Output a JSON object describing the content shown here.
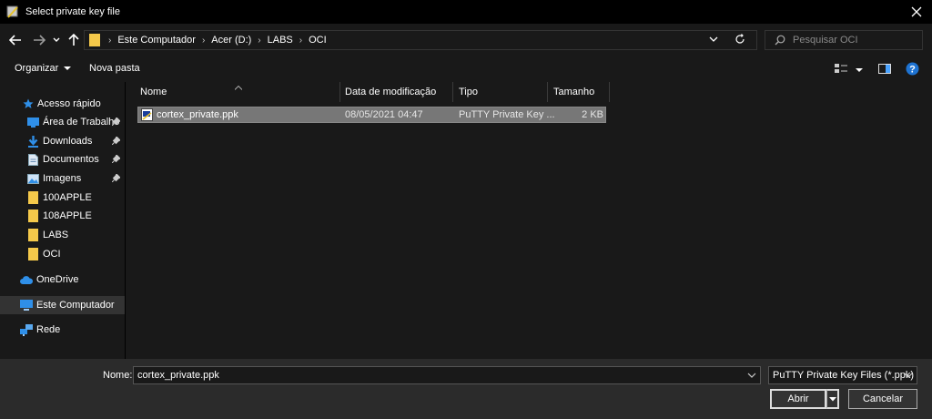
{
  "window": {
    "title": "Select private key file"
  },
  "address": {
    "crumbs": [
      "Este Computador",
      "Acer (D:)",
      "LABS",
      "OCI"
    ]
  },
  "search": {
    "placeholder": "Pesquisar OCI"
  },
  "toolbar": {
    "organize_label": "Organizar",
    "new_folder_label": "Nova pasta"
  },
  "sidebar": {
    "quick_access": "Acesso rápido",
    "items": [
      {
        "label": "Área de Trabalho",
        "icon": "desktop-icon",
        "pinned": true
      },
      {
        "label": "Downloads",
        "icon": "download-icon",
        "pinned": true
      },
      {
        "label": "Documentos",
        "icon": "document-icon",
        "pinned": true
      },
      {
        "label": "Imagens",
        "icon": "image-icon",
        "pinned": true
      },
      {
        "label": "100APPLE",
        "icon": "folder-icon",
        "pinned": false
      },
      {
        "label": "108APPLE",
        "icon": "folder-icon",
        "pinned": false
      },
      {
        "label": "LABS",
        "icon": "folder-icon",
        "pinned": false
      },
      {
        "label": "OCI",
        "icon": "folder-icon",
        "pinned": false
      }
    ],
    "onedrive": "OneDrive",
    "this_pc": "Este Computador",
    "network": "Rede"
  },
  "columns": {
    "name": "Nome",
    "date": "Data de modificação",
    "type": "Tipo",
    "size": "Tamanho"
  },
  "files": [
    {
      "name": "cortex_private.ppk",
      "date": "08/05/2021 04:47",
      "type": "PuTTY Private Key ...",
      "size": "2 KB"
    }
  ],
  "footer": {
    "name_label": "Nome:",
    "name_value": "cortex_private.ppk",
    "filter_value": "PuTTY Private Key Files (*.ppk)",
    "open_label": "Abrir",
    "cancel_label": "Cancelar"
  },
  "colors": {
    "accent": "#0078d7",
    "folder": "#f5c94a"
  }
}
